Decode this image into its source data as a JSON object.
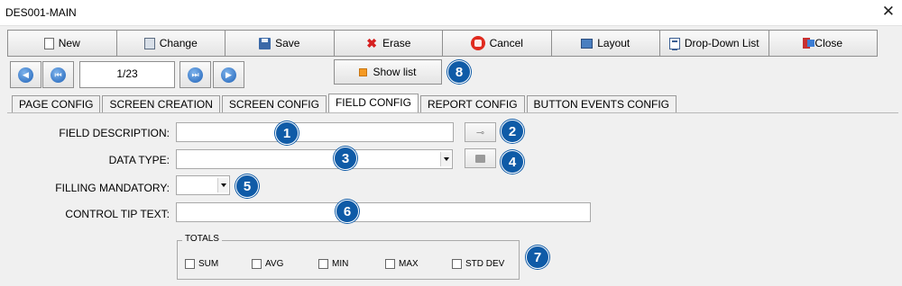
{
  "window": {
    "title": "DES001-MAIN",
    "close_symbol": "✕"
  },
  "toolbar": {
    "buttons": [
      {
        "label": "New",
        "icon": "new-document-icon"
      },
      {
        "label": "Change",
        "icon": "edit-document-icon"
      },
      {
        "label": "Save",
        "icon": "floppy-disk-icon"
      },
      {
        "label": "Erase",
        "icon": "red-x-icon"
      },
      {
        "label": "Cancel",
        "icon": "stop-hand-icon"
      },
      {
        "label": "Layout",
        "icon": "layout-icon"
      },
      {
        "label": "Drop-Down List",
        "icon": "list-icon"
      },
      {
        "label": "Close",
        "icon": "exit-door-icon"
      }
    ]
  },
  "navigation": {
    "page_indicator": "1/23",
    "show_list_label": "Show list"
  },
  "tabs": [
    {
      "label": "PAGE CONFIG",
      "active": false
    },
    {
      "label": "SCREEN CREATION",
      "active": false
    },
    {
      "label": "SCREEN CONFIG",
      "active": false
    },
    {
      "label": "FIELD CONFIG",
      "active": true
    },
    {
      "label": "REPORT CONFIG",
      "active": false
    },
    {
      "label": "BUTTON EVENTS CONFIG",
      "active": false
    }
  ],
  "form": {
    "field_description_label": "FIELD DESCRIPTION:",
    "field_description_value": "",
    "data_type_label": "DATA TYPE:",
    "data_type_value": "",
    "filling_mandatory_label": "FILLING MANDATORY:",
    "filling_mandatory_value": "",
    "control_tip_label": "CONTROL TIP TEXT:",
    "control_tip_value": ""
  },
  "totals": {
    "legend": "TOTALS",
    "options": [
      {
        "label": "SUM",
        "checked": false
      },
      {
        "label": "AVG",
        "checked": false
      },
      {
        "label": "MIN",
        "checked": false
      },
      {
        "label": "MAX",
        "checked": false
      },
      {
        "label": "STD DEV",
        "checked": false
      }
    ]
  },
  "badges": [
    "1",
    "2",
    "3",
    "4",
    "5",
    "6",
    "7",
    "8"
  ],
  "colors": {
    "badge": "#0f5ba7",
    "nav_blue": "#1f62b8",
    "background": "#f0f0f0"
  }
}
